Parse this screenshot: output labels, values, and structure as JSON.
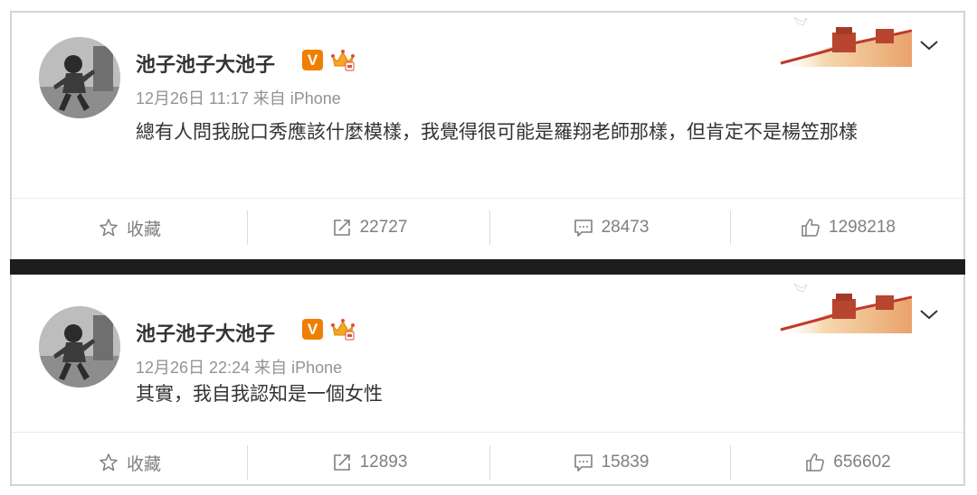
{
  "posts": [
    {
      "username": "池子池子大池子",
      "verified_badge": "V",
      "meta": "12月26日 11:17 来自 iPhone",
      "content": "總有人問我脫口秀應該什麼模樣，我覺得很可能是羅翔老師那樣，但肯定不是楊笠那樣",
      "actions": {
        "favorite": "收藏",
        "repost_count": "22727",
        "comment_count": "28473",
        "like_count": "1298218"
      }
    },
    {
      "username": "池子池子大池子",
      "verified_badge": "V",
      "meta": "12月26日 22:24 来自 iPhone",
      "content": "其實，我自我認知是一個女性",
      "actions": {
        "favorite": "收藏",
        "repost_count": "12893",
        "comment_count": "15839",
        "like_count": "656602"
      }
    }
  ],
  "icons": {
    "favorite": "star-outline-icon",
    "repost": "share-arrow-icon",
    "comment": "comment-bubble-icon",
    "like": "thumbs-up-icon",
    "menu": "chevron-down-icon"
  },
  "colors": {
    "verified_badge": "#f07f00",
    "separator": "#1d1d1d",
    "meta_text": "#939393",
    "action_text": "#7f7f7f"
  }
}
